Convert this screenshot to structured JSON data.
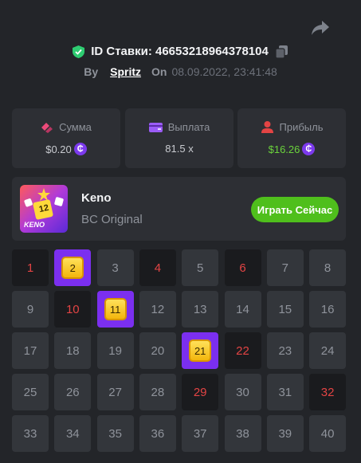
{
  "header": {
    "bet_id": "ID Ставки: 46653218964378104",
    "by_label": "By",
    "user": "Spritz",
    "on_label": "On",
    "date": "08.09.2022, 23:41:48",
    "icons": [
      "share-icon",
      "shield-check-icon",
      "copy-icon"
    ],
    "shield_color": "#2ecc71"
  },
  "stats": [
    {
      "label": "Сумма",
      "value": "$0.20",
      "icon": "chips-icon",
      "icon_color": "#ec4a7a",
      "coin": "₵"
    },
    {
      "label": "Выплата",
      "value": "81.5 x",
      "icon": "wallet-icon",
      "icon_color": "#9b5cf6"
    },
    {
      "label": "Прибыль",
      "value": "$16.26",
      "icon": "user-profit-icon",
      "icon_color": "#e34444",
      "coin": "₵",
      "value_color": "#6bd33c"
    }
  ],
  "game": {
    "name": "Keno",
    "subtitle": "BC Original",
    "play_label": "Играть Сейчас",
    "thumb_label": "KENO",
    "thumb_number": "12"
  },
  "grid": [
    {
      "n": "1",
      "state": "miss"
    },
    {
      "n": "2",
      "state": "hit"
    },
    {
      "n": "3",
      "state": "none"
    },
    {
      "n": "4",
      "state": "miss"
    },
    {
      "n": "5",
      "state": "none"
    },
    {
      "n": "6",
      "state": "miss"
    },
    {
      "n": "7",
      "state": "none"
    },
    {
      "n": "8",
      "state": "none"
    },
    {
      "n": "9",
      "state": "none"
    },
    {
      "n": "10",
      "state": "miss"
    },
    {
      "n": "11",
      "state": "hit"
    },
    {
      "n": "12",
      "state": "none"
    },
    {
      "n": "13",
      "state": "none"
    },
    {
      "n": "14",
      "state": "none"
    },
    {
      "n": "15",
      "state": "none"
    },
    {
      "n": "16",
      "state": "none"
    },
    {
      "n": "17",
      "state": "none"
    },
    {
      "n": "18",
      "state": "none"
    },
    {
      "n": "19",
      "state": "none"
    },
    {
      "n": "20",
      "state": "none"
    },
    {
      "n": "21",
      "state": "hit"
    },
    {
      "n": "22",
      "state": "miss"
    },
    {
      "n": "23",
      "state": "none"
    },
    {
      "n": "24",
      "state": "none"
    },
    {
      "n": "25",
      "state": "none"
    },
    {
      "n": "26",
      "state": "none"
    },
    {
      "n": "27",
      "state": "none"
    },
    {
      "n": "28",
      "state": "none"
    },
    {
      "n": "29",
      "state": "miss"
    },
    {
      "n": "30",
      "state": "none"
    },
    {
      "n": "31",
      "state": "none"
    },
    {
      "n": "32",
      "state": "miss"
    },
    {
      "n": "33",
      "state": "none"
    },
    {
      "n": "34",
      "state": "none"
    },
    {
      "n": "35",
      "state": "none"
    },
    {
      "n": "36",
      "state": "none"
    },
    {
      "n": "37",
      "state": "none"
    },
    {
      "n": "38",
      "state": "none"
    },
    {
      "n": "39",
      "state": "none"
    },
    {
      "n": "40",
      "state": "none"
    }
  ]
}
